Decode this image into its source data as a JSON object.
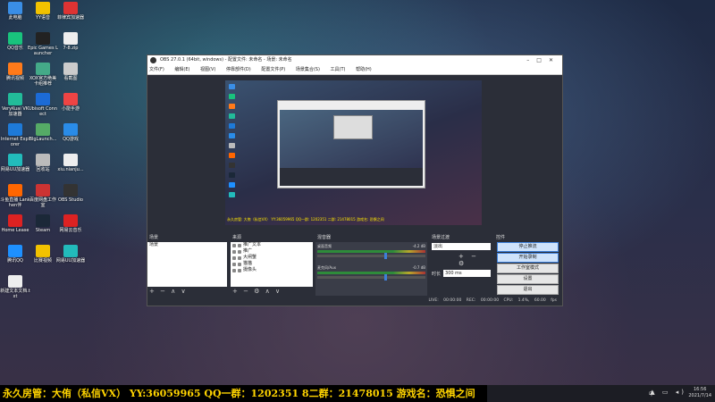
{
  "desktop": {
    "icons": [
      {
        "label": "此电脑",
        "color": "#3a8ee6"
      },
      {
        "label": "YY语音",
        "color": "#f2c200"
      },
      {
        "label": "菲律宾加速器",
        "color": "#d33"
      },
      {
        "label": "QQ音乐",
        "color": "#19c37d"
      },
      {
        "label": "Epic Games Launcher",
        "color": "#222"
      },
      {
        "label": "7-8.zip",
        "color": "#eee"
      },
      {
        "label": "腾讯视频",
        "color": "#ff7a1a"
      },
      {
        "label": "XOX官方绝美卡组推荐",
        "color": "#4a8"
      },
      {
        "label": "看截图",
        "color": "#ccc"
      },
      {
        "label": "VeryKuai VK加速器",
        "color": "#2b9"
      },
      {
        "label": "Ubisoft Connect",
        "color": "#1c6bd6"
      },
      {
        "label": "小能手游",
        "color": "#e44"
      },
      {
        "label": "Internet Explorer",
        "color": "#1e7ad8"
      },
      {
        "label": "BlgLaunch...",
        "color": "#5a6"
      },
      {
        "label": "QQ游戏",
        "color": "#2a8ce8"
      },
      {
        "label": "网易UU加速器",
        "color": "#2bb"
      },
      {
        "label": "回收站",
        "color": "#bbb"
      },
      {
        "label": "xiu.nianju...",
        "color": "#eee"
      },
      {
        "label": "斗鱼直播 Lankhen伴",
        "color": "#f60"
      },
      {
        "label": "百度网盘工作室",
        "color": "#c33"
      },
      {
        "label": "OBS Studio",
        "color": "#333"
      },
      {
        "label": "Home Lease",
        "color": "#d22"
      },
      {
        "label": "Steam",
        "color": "#1b2838"
      },
      {
        "label": "网易云音乐",
        "color": "#d22"
      },
      {
        "label": "腾讯QQ",
        "color": "#1e90ff"
      },
      {
        "label": "比赛视频",
        "color": "#f2c200"
      },
      {
        "label": "网易UU加速器",
        "color": "#2bb"
      },
      {
        "label": "新建文本文档.txt",
        "color": "#eee"
      }
    ]
  },
  "obs": {
    "title": "OBS 27.0.1 (64bit, windows) - 配置文件: 未命名 - 场景: 未命名",
    "menu": [
      "文件(F)",
      "编辑(E)",
      "视图(V)",
      "停靠部件(D)",
      "配置文件(P)",
      "场景集合(S)",
      "工具(T)",
      "帮助(H)"
    ],
    "preview_ticker": "永久房管: 大侑（私信VX） YY:36059965 QQ一群: 1202351 二群: 21478015 游戏名: 恐惧之间",
    "docks": {
      "scenes": {
        "title": "场景",
        "items": [
          "场景"
        ],
        "footer": "+ − ∧ ∨"
      },
      "sources": {
        "title": "来源",
        "items": [
          "推广文本",
          "推广",
          "大闸蟹",
          "猫猫",
          "摄像头"
        ],
        "footer": "+ − ⚙ ∧ ∨"
      },
      "mixer": {
        "title": "混音器",
        "channels": [
          {
            "name": "桌面音频",
            "db": "-4.2 dB",
            "level": 0.62
          },
          {
            "name": "麦克风/Aux",
            "db": "-0.7 dB",
            "level": 0.62
          }
        ]
      },
      "transitions": {
        "title": "场景过渡",
        "type": "淡出",
        "duration_label": "时长",
        "duration": "300 ms"
      },
      "controls": {
        "title": "控件",
        "buttons": [
          "停止推流",
          "开始录制",
          "工作室模式",
          "设置",
          "退出"
        ]
      }
    },
    "status": "LIVE: 00:00:00   REC: 00:00:00   CPU: 1.4%, 60.00 fps"
  },
  "ticker": {
    "text": "永久房管：大侑（私信VX） YY:36059965 QQ一群：1202351 8二群：21478015 游戏名：恐惧之间"
  },
  "taskbar": {
    "lang": "中",
    "time": "16:56",
    "date": "2021/7/14"
  }
}
